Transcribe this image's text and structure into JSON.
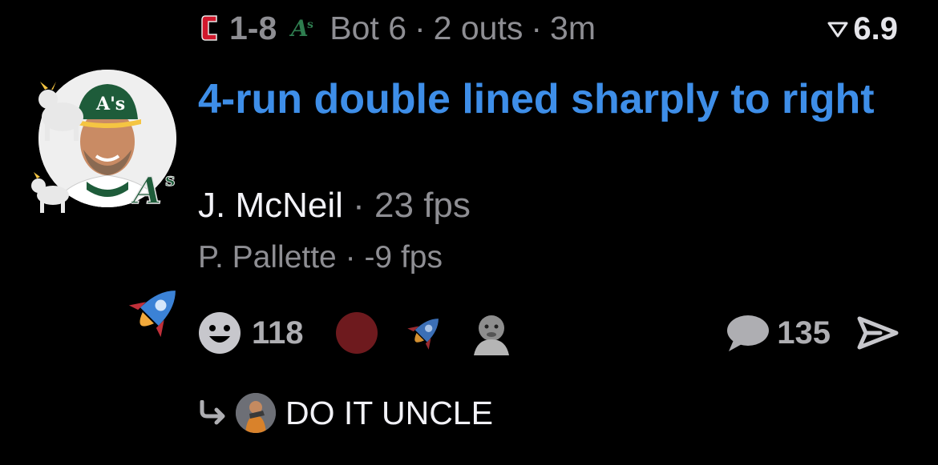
{
  "header": {
    "away_team_icon": "cleveland-c-logo-icon",
    "score": "1-8",
    "home_team_icon": "athletics-logo-icon",
    "inning": "Bot 6",
    "outs": "2 outs",
    "age": "3m",
    "rating_icon": "funnel-icon",
    "rating": "6.9"
  },
  "play": {
    "avatar_icon": "player-headshot-avatar",
    "headline": "4-run double lined sharply to right",
    "batter_name": "J. McNeil",
    "batter_stat": "23 fps",
    "pitcher_name": "P. Pallette",
    "pitcher_stat": "-9 fps",
    "sep": "·"
  },
  "reactions": {
    "side_icon": "rocket-icon",
    "smiley_count": "118",
    "comment_count": "135"
  },
  "reply": {
    "text": "DO IT UNCLE"
  },
  "colors": {
    "headline": "#3e8ee8",
    "muted": "#8e8e93",
    "cleveland_red": "#d0182c",
    "athletics_green": "#1e5c3a",
    "red_dot": "#6e1a1e"
  }
}
